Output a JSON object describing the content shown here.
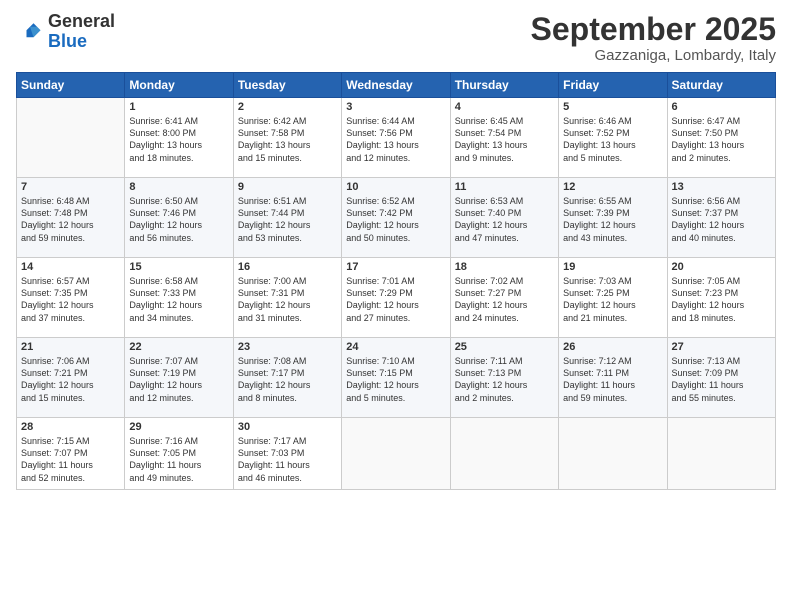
{
  "logo": {
    "general": "General",
    "blue": "Blue"
  },
  "title": "September 2025",
  "location": "Gazzaniga, Lombardy, Italy",
  "days_of_week": [
    "Sunday",
    "Monday",
    "Tuesday",
    "Wednesday",
    "Thursday",
    "Friday",
    "Saturday"
  ],
  "weeks": [
    [
      {
        "day": "",
        "content": ""
      },
      {
        "day": "1",
        "content": "Sunrise: 6:41 AM\nSunset: 8:00 PM\nDaylight: 13 hours\nand 18 minutes."
      },
      {
        "day": "2",
        "content": "Sunrise: 6:42 AM\nSunset: 7:58 PM\nDaylight: 13 hours\nand 15 minutes."
      },
      {
        "day": "3",
        "content": "Sunrise: 6:44 AM\nSunset: 7:56 PM\nDaylight: 13 hours\nand 12 minutes."
      },
      {
        "day": "4",
        "content": "Sunrise: 6:45 AM\nSunset: 7:54 PM\nDaylight: 13 hours\nand 9 minutes."
      },
      {
        "day": "5",
        "content": "Sunrise: 6:46 AM\nSunset: 7:52 PM\nDaylight: 13 hours\nand 5 minutes."
      },
      {
        "day": "6",
        "content": "Sunrise: 6:47 AM\nSunset: 7:50 PM\nDaylight: 13 hours\nand 2 minutes."
      }
    ],
    [
      {
        "day": "7",
        "content": "Sunrise: 6:48 AM\nSunset: 7:48 PM\nDaylight: 12 hours\nand 59 minutes."
      },
      {
        "day": "8",
        "content": "Sunrise: 6:50 AM\nSunset: 7:46 PM\nDaylight: 12 hours\nand 56 minutes."
      },
      {
        "day": "9",
        "content": "Sunrise: 6:51 AM\nSunset: 7:44 PM\nDaylight: 12 hours\nand 53 minutes."
      },
      {
        "day": "10",
        "content": "Sunrise: 6:52 AM\nSunset: 7:42 PM\nDaylight: 12 hours\nand 50 minutes."
      },
      {
        "day": "11",
        "content": "Sunrise: 6:53 AM\nSunset: 7:40 PM\nDaylight: 12 hours\nand 47 minutes."
      },
      {
        "day": "12",
        "content": "Sunrise: 6:55 AM\nSunset: 7:39 PM\nDaylight: 12 hours\nand 43 minutes."
      },
      {
        "day": "13",
        "content": "Sunrise: 6:56 AM\nSunset: 7:37 PM\nDaylight: 12 hours\nand 40 minutes."
      }
    ],
    [
      {
        "day": "14",
        "content": "Sunrise: 6:57 AM\nSunset: 7:35 PM\nDaylight: 12 hours\nand 37 minutes."
      },
      {
        "day": "15",
        "content": "Sunrise: 6:58 AM\nSunset: 7:33 PM\nDaylight: 12 hours\nand 34 minutes."
      },
      {
        "day": "16",
        "content": "Sunrise: 7:00 AM\nSunset: 7:31 PM\nDaylight: 12 hours\nand 31 minutes."
      },
      {
        "day": "17",
        "content": "Sunrise: 7:01 AM\nSunset: 7:29 PM\nDaylight: 12 hours\nand 27 minutes."
      },
      {
        "day": "18",
        "content": "Sunrise: 7:02 AM\nSunset: 7:27 PM\nDaylight: 12 hours\nand 24 minutes."
      },
      {
        "day": "19",
        "content": "Sunrise: 7:03 AM\nSunset: 7:25 PM\nDaylight: 12 hours\nand 21 minutes."
      },
      {
        "day": "20",
        "content": "Sunrise: 7:05 AM\nSunset: 7:23 PM\nDaylight: 12 hours\nand 18 minutes."
      }
    ],
    [
      {
        "day": "21",
        "content": "Sunrise: 7:06 AM\nSunset: 7:21 PM\nDaylight: 12 hours\nand 15 minutes."
      },
      {
        "day": "22",
        "content": "Sunrise: 7:07 AM\nSunset: 7:19 PM\nDaylight: 12 hours\nand 12 minutes."
      },
      {
        "day": "23",
        "content": "Sunrise: 7:08 AM\nSunset: 7:17 PM\nDaylight: 12 hours\nand 8 minutes."
      },
      {
        "day": "24",
        "content": "Sunrise: 7:10 AM\nSunset: 7:15 PM\nDaylight: 12 hours\nand 5 minutes."
      },
      {
        "day": "25",
        "content": "Sunrise: 7:11 AM\nSunset: 7:13 PM\nDaylight: 12 hours\nand 2 minutes."
      },
      {
        "day": "26",
        "content": "Sunrise: 7:12 AM\nSunset: 7:11 PM\nDaylight: 11 hours\nand 59 minutes."
      },
      {
        "day": "27",
        "content": "Sunrise: 7:13 AM\nSunset: 7:09 PM\nDaylight: 11 hours\nand 55 minutes."
      }
    ],
    [
      {
        "day": "28",
        "content": "Sunrise: 7:15 AM\nSunset: 7:07 PM\nDaylight: 11 hours\nand 52 minutes."
      },
      {
        "day": "29",
        "content": "Sunrise: 7:16 AM\nSunset: 7:05 PM\nDaylight: 11 hours\nand 49 minutes."
      },
      {
        "day": "30",
        "content": "Sunrise: 7:17 AM\nSunset: 7:03 PM\nDaylight: 11 hours\nand 46 minutes."
      },
      {
        "day": "",
        "content": ""
      },
      {
        "day": "",
        "content": ""
      },
      {
        "day": "",
        "content": ""
      },
      {
        "day": "",
        "content": ""
      }
    ]
  ]
}
